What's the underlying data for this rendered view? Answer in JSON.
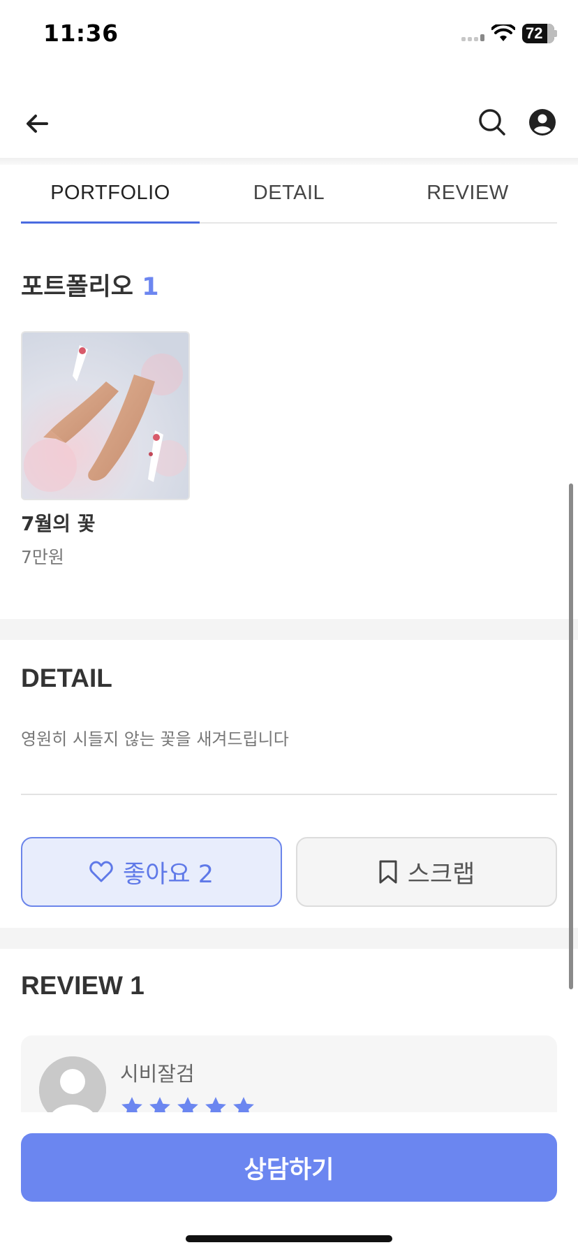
{
  "status_bar": {
    "time": "11:36",
    "battery": "72"
  },
  "app_bar": {
    "back_icon": "arrow-left-icon",
    "search_icon": "search-icon",
    "account_icon": "account-circle-icon"
  },
  "tabs": [
    {
      "label": "PORTFOLIO",
      "active": true
    },
    {
      "label": "DETAIL",
      "active": false
    },
    {
      "label": "REVIEW",
      "active": false
    }
  ],
  "portfolio": {
    "title": "포트폴리오",
    "count": "1",
    "items": [
      {
        "name": "7월의 꽃",
        "price": "7만원"
      }
    ]
  },
  "detail": {
    "title": "DETAIL",
    "text": "영원히 시들지 않는 꽃을 새겨드립니다"
  },
  "actions": {
    "like_label": "좋아요 2",
    "like_icon": "heart-outline-icon",
    "scrap_label": "스크랩",
    "scrap_icon": "bookmark-outline-icon"
  },
  "review": {
    "title": "REVIEW 1",
    "items": [
      {
        "author": "시비잘검",
        "rating": 5
      }
    ]
  },
  "cta": {
    "label": "상담하기"
  },
  "colors": {
    "accent": "#6b86f0",
    "like_bg": "#e8edfc",
    "star": "#6b86f0"
  }
}
